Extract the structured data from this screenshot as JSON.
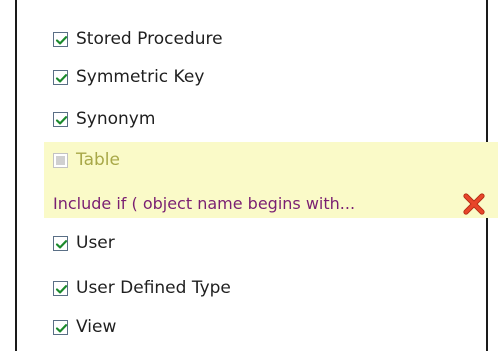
{
  "items": [
    {
      "label": "Stored Procedure",
      "checked": true
    },
    {
      "label": "Symmetric Key",
      "checked": true
    },
    {
      "label": "Synonym",
      "checked": true
    },
    {
      "label": "Table",
      "checked": false,
      "state": "disabled"
    },
    {
      "label": "User",
      "checked": true
    },
    {
      "label": "User Defined Type",
      "checked": true
    },
    {
      "label": "View",
      "checked": true
    }
  ],
  "rule": {
    "text": "Include if  ( object name begins with...",
    "remove_icon": "red-x-icon"
  },
  "colors": {
    "highlight_bg": "#fafac8",
    "rule_text": "#7a1f72",
    "check_green": "#1b8a2c",
    "remove_red": "#d9361c"
  }
}
